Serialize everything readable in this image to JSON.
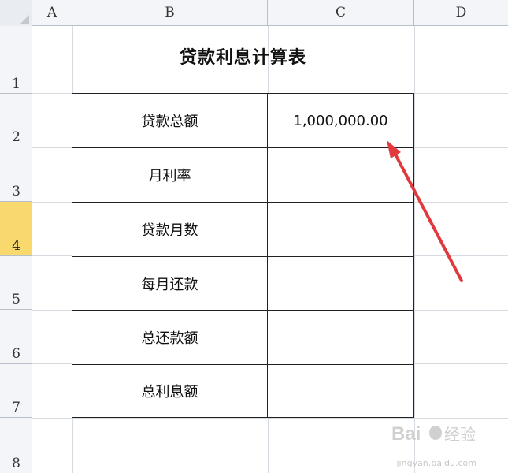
{
  "columns": [
    "A",
    "B",
    "C",
    "D"
  ],
  "rows": [
    "1",
    "2",
    "3",
    "4",
    "5",
    "6",
    "7",
    "8"
  ],
  "active_row": "4",
  "sheet": {
    "title": "贷款利息计算表",
    "items": [
      {
        "label": "贷款总额",
        "value": "1,000,000.00"
      },
      {
        "label": "月利率",
        "value": ""
      },
      {
        "label": "贷款月数",
        "value": ""
      },
      {
        "label": "每月还款",
        "value": ""
      },
      {
        "label": "总还款额",
        "value": ""
      },
      {
        "label": "总利息额",
        "value": ""
      }
    ]
  },
  "annotation": {
    "color": "#e03a3e",
    "type": "arrow"
  },
  "watermark": {
    "brand": "Bai 经验",
    "site": "jingyan.baidu.com"
  },
  "colors": {
    "header_bg": "#f3f5f8",
    "active_row_bg": "#f9d96e",
    "grid": "#d6dbe2"
  }
}
